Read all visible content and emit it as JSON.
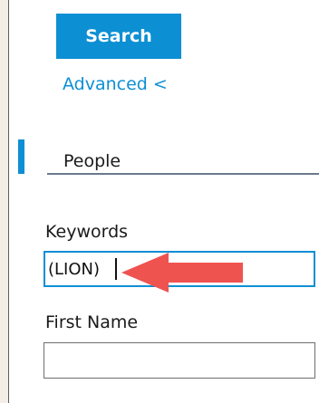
{
  "header": {
    "search_tab_label": "Search",
    "advanced_link_label": "Advanced <"
  },
  "section": {
    "title": "People"
  },
  "fields": {
    "keywords": {
      "label": "Keywords",
      "value": "(LION)"
    },
    "first_name": {
      "label": "First Name",
      "value": ""
    }
  },
  "colors": {
    "accent": "#0d8fd4",
    "annotation_arrow": "#ef5350"
  },
  "annotation": {
    "icon": "red-arrow-pointing-left"
  }
}
